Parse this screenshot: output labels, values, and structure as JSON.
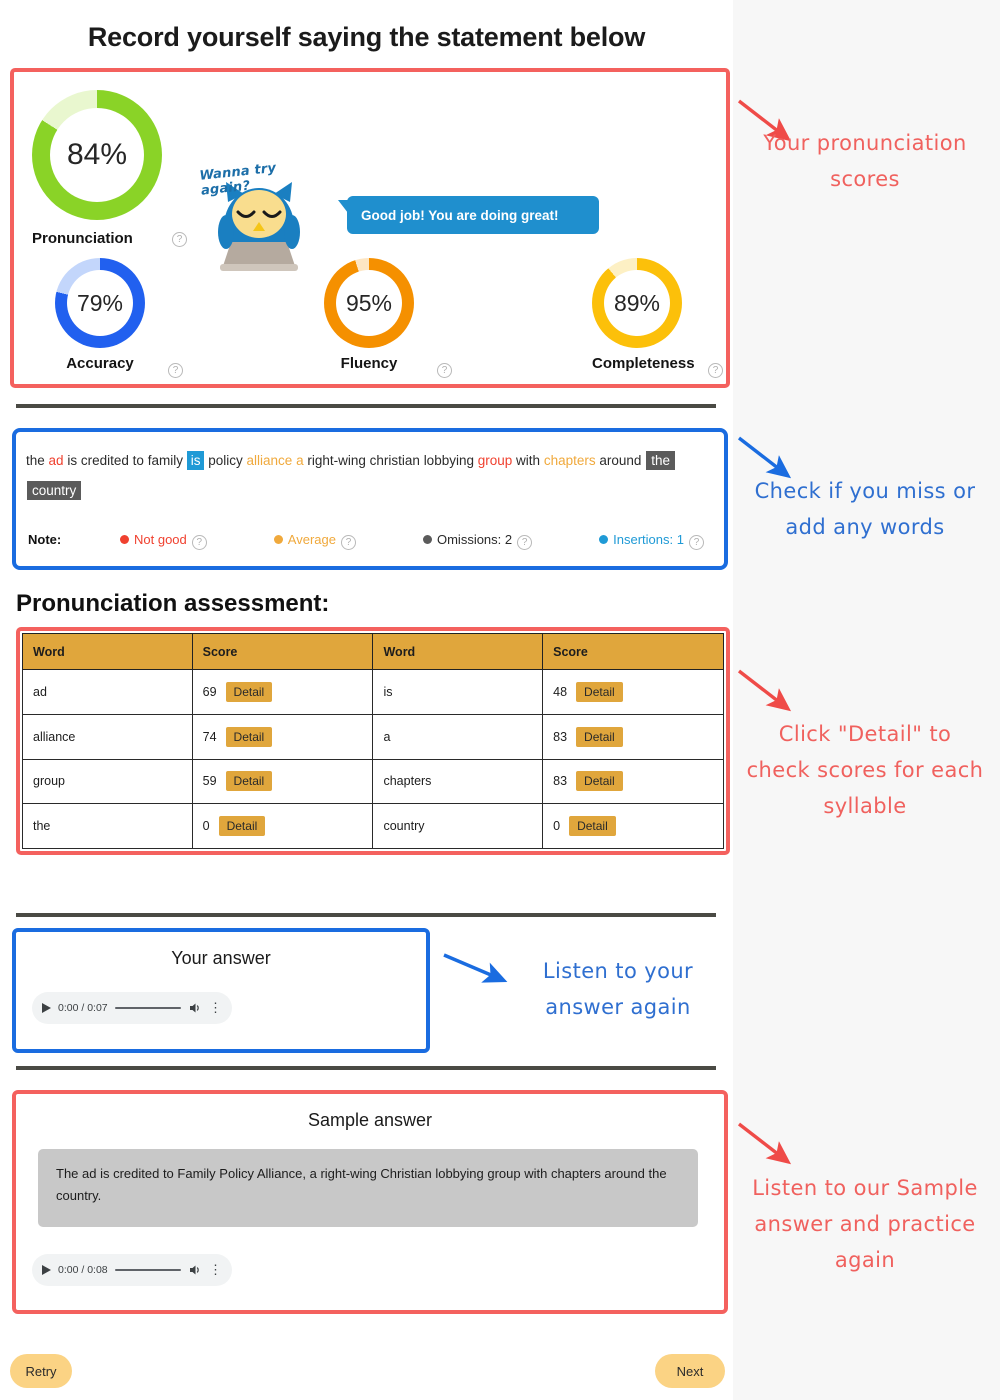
{
  "page": {
    "title": "Record yourself saying the statement below",
    "bg_main": "#ffffff",
    "bg_annotation": "#f7f7f7"
  },
  "scores": {
    "mascot_caption": "Wanna try again?",
    "bubble_message": "Good job! You are doing great!",
    "accent_red": "#f4615e",
    "accent_blue": "#1a6ce0",
    "metrics": [
      {
        "label": "Pronunciation",
        "value": 84,
        "display": "84%",
        "color": "#8ad327",
        "track": "#e9f7cf"
      },
      {
        "label": "Accuracy",
        "value": 79,
        "display": "79%",
        "color": "#2160ef",
        "track": "#c3d6fb"
      },
      {
        "label": "Fluency",
        "value": 95,
        "display": "95%",
        "color": "#f59000",
        "track": "#fde6c4"
      },
      {
        "label": "Completeness",
        "value": 89,
        "display": "89%",
        "color": "#fcc00a",
        "track": "#fdf0c4"
      }
    ],
    "help_icon": "?"
  },
  "transcript": {
    "words": [
      {
        "text": "the",
        "kind": "normal"
      },
      {
        "text": "ad",
        "kind": "bad"
      },
      {
        "text": "is",
        "kind": "normal"
      },
      {
        "text": "credited",
        "kind": "normal"
      },
      {
        "text": "to",
        "kind": "normal"
      },
      {
        "text": "family",
        "kind": "normal"
      },
      {
        "text": "is",
        "kind": "insertion"
      },
      {
        "text": "policy",
        "kind": "normal"
      },
      {
        "text": "alliance",
        "kind": "average"
      },
      {
        "text": "a",
        "kind": "average"
      },
      {
        "text": "right-wing",
        "kind": "normal"
      },
      {
        "text": "christian",
        "kind": "normal"
      },
      {
        "text": "lobbying",
        "kind": "normal"
      },
      {
        "text": "group",
        "kind": "bad"
      },
      {
        "text": "with",
        "kind": "normal"
      },
      {
        "text": "chapters",
        "kind": "average"
      },
      {
        "text": "around",
        "kind": "normal"
      },
      {
        "text": "the",
        "kind": "omission"
      },
      {
        "text": "country",
        "kind": "omission"
      }
    ],
    "note_label": "Note:",
    "legend": [
      {
        "label": "Not good",
        "color": "#f0412f",
        "text_color": "#f0412f"
      },
      {
        "label": "Average",
        "color": "#f0a93c",
        "text_color": "#f0a93c"
      },
      {
        "label": "Omissions: 2",
        "color": "#5b5b5b",
        "text_color": "#2b2b2b"
      },
      {
        "label": "Insertions: 1",
        "color": "#1f9ad6",
        "text_color": "#1f9ad6"
      }
    ],
    "help_icon": "?"
  },
  "assessment": {
    "heading": "Pronunciation assessment:",
    "headers": [
      "Word",
      "Score",
      "Word",
      "Score"
    ],
    "detail_label": "Detail",
    "rows": [
      {
        "word_a": "ad",
        "score_a": "69",
        "word_b": "is",
        "score_b": "48"
      },
      {
        "word_a": "alliance",
        "score_a": "74",
        "word_b": "a",
        "score_b": "83"
      },
      {
        "word_a": "group",
        "score_a": "59",
        "word_b": "chapters",
        "score_b": "83"
      },
      {
        "word_a": "the",
        "score_a": "0",
        "word_b": "country",
        "score_b": "0"
      }
    ],
    "header_bg": "#e0a63c"
  },
  "your_answer": {
    "title": "Your answer",
    "player": {
      "time": "0:00 / 0:07"
    }
  },
  "sample_answer": {
    "title": "Sample answer",
    "text": "The ad is credited to Family Policy Alliance, a right-wing Christian lobbying group with chapters around the country.",
    "player": {
      "time": "0:00 / 0:08"
    }
  },
  "footer": {
    "retry_label": "Retry",
    "next_label": "Next"
  },
  "annotations": [
    {
      "id": "scores",
      "text": "Your pronunciation scores",
      "color": "#f0615e"
    },
    {
      "id": "words",
      "text": "Check if you miss or add any words",
      "color": "#2f6fd0"
    },
    {
      "id": "detail",
      "text": "Click \"Detail\" to check scores for each syllable",
      "color": "#f0615e"
    },
    {
      "id": "listen",
      "text": "Listen to your answer again",
      "color": "#2f6fd0"
    },
    {
      "id": "practice",
      "text": "Listen to our Sample answer and practice again",
      "color": "#f0615e"
    }
  ]
}
